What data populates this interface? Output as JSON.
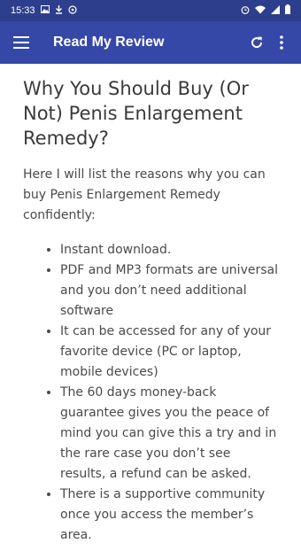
{
  "status_bar": {
    "time": "15:33",
    "left_icons": [
      "image-icon",
      "download-icon",
      "circle-icon"
    ],
    "right_icons": [
      "alarm-icon",
      "wifi-icon",
      "signal-icon",
      "battery-icon"
    ]
  },
  "app_bar": {
    "title": "Read My Review",
    "menu_icon": "hamburger-menu-icon",
    "refresh_icon": "refresh-icon",
    "more_icon": "more-vertical-icon",
    "color": "#3548a8"
  },
  "article": {
    "title": "Why You Should Buy (Or Not) Penis Enlargement Remedy?",
    "intro": "Here I will list the reasons why you can buy Penis Enlargement Remedy confidently:",
    "reasons": [
      "Instant download.",
      "PDF and MP3 formats are universal and you don’t need additional software",
      "It can be accessed for any of your favorite device (PC or laptop, mobile devices)",
      "The 60 days money-back guarantee gives you the peace of mind you can give this a try and in the rare case you don’t see results, a refund can be asked.",
      "There is a supportive community once you access the member’s area."
    ]
  }
}
